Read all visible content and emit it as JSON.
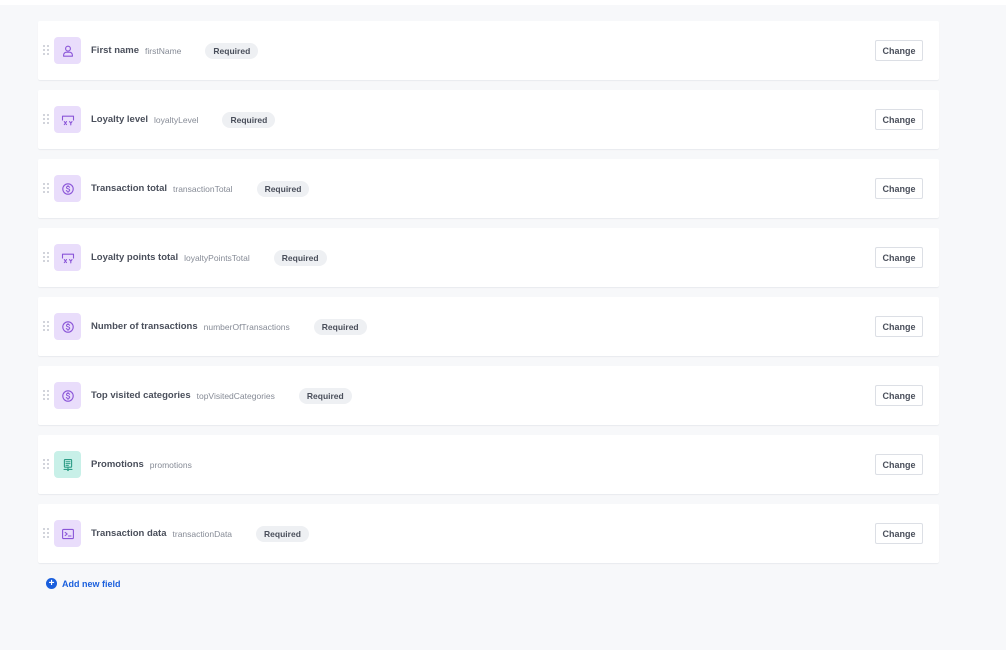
{
  "fields": [
    {
      "name": "First name",
      "key": "firstName",
      "badge": "Required",
      "icon": "person-icon",
      "icon_color": "purple",
      "action": "Change"
    },
    {
      "name": "Loyalty level",
      "key": "loyaltyLevel",
      "badge": "Required",
      "icon": "variable-icon",
      "icon_color": "purple",
      "action": "Change"
    },
    {
      "name": "Transaction total",
      "key": "transactionTotal",
      "badge": "Required",
      "icon": "currency-icon",
      "icon_color": "purple",
      "action": "Change"
    },
    {
      "name": "Loyalty points total",
      "key": "loyaltyPointsTotal",
      "badge": "Required",
      "icon": "variable-icon",
      "icon_color": "purple",
      "action": "Change"
    },
    {
      "name": "Number of transactions",
      "key": "numberOfTransactions",
      "badge": "Required",
      "icon": "currency-icon",
      "icon_color": "purple",
      "action": "Change"
    },
    {
      "name": "Top visited categories",
      "key": "topVisitedCategories",
      "badge": "Required",
      "icon": "currency-icon",
      "icon_color": "purple",
      "action": "Change"
    },
    {
      "name": "Promotions",
      "key": "promotions",
      "badge": "",
      "icon": "catalog-icon",
      "icon_color": "teal",
      "action": "Change"
    },
    {
      "name": "Transaction data",
      "key": "transactionData",
      "badge": "Required",
      "icon": "terminal-icon",
      "icon_color": "purple",
      "action": "Change"
    }
  ],
  "add_field": {
    "label": "Add new field",
    "icon": "plus-circle-icon"
  },
  "colors": {
    "accent": "#1a5fdd",
    "icon_purple_bg": "#e9ddfb",
    "icon_purple_fg": "#8a55d8",
    "icon_teal_bg": "#c8f0e8",
    "icon_teal_fg": "#2d9c86",
    "badge_bg": "#eef0f3"
  }
}
